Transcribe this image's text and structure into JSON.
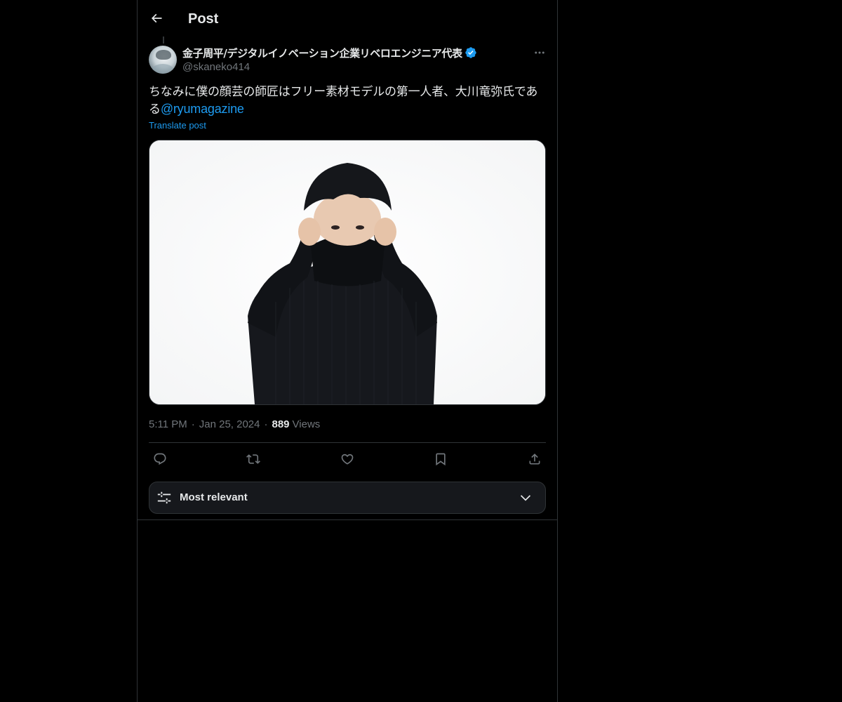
{
  "header": {
    "back_icon": "arrow-left-icon",
    "title": "Post"
  },
  "post": {
    "author_name": "金子周平/デジタルイノベーション企業リベロエンジニア代表",
    "verified_icon": "verified-badge-icon",
    "verified_color": "#1d9bf0",
    "handle": "@skaneko414",
    "more_icon": "more-horizontal-icon",
    "text_main": "ちなみに僕の顔芸の師匠はフリー素材モデルの第一人者、大川竜弥氏である",
    "mention": "@ryumagazine",
    "translate_label": "Translate post",
    "media_icon": "photo-man-black-turtleneck",
    "time": "5:11 PM",
    "separator": "·",
    "date": "Jan 25, 2024",
    "views_count": "889",
    "views_label": "Views"
  },
  "actions": [
    {
      "name": "reply",
      "icon": "reply-bubble-icon"
    },
    {
      "name": "repost",
      "icon": "repost-icon"
    },
    {
      "name": "like",
      "icon": "heart-icon"
    },
    {
      "name": "bookmark",
      "icon": "bookmark-icon"
    },
    {
      "name": "share",
      "icon": "share-upload-icon"
    }
  ],
  "replies_sort": {
    "icon": "sliders-icon",
    "label": "Most relevant",
    "dropdown_icon": "chevron-down-icon"
  },
  "colors": {
    "background": "#000000",
    "text": "#e7e9ea",
    "muted": "#71767b",
    "link": "#1d9bf0",
    "border": "#2f3336"
  }
}
